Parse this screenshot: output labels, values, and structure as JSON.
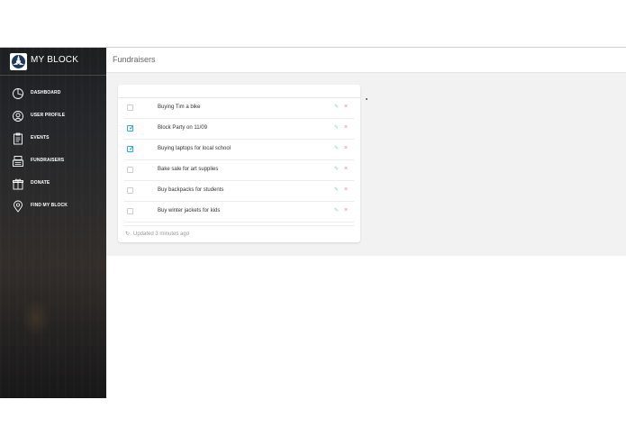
{
  "brand": {
    "name": "MY BLOCK"
  },
  "sidebar": {
    "items": [
      {
        "label": "DASHBOARD",
        "icon": "pie-chart-icon"
      },
      {
        "label": "USER PROFILE",
        "icon": "user-icon"
      },
      {
        "label": "EVENTS",
        "icon": "clipboard-icon"
      },
      {
        "label": "FUNDRAISERS",
        "icon": "cash-register-icon"
      },
      {
        "label": "DONATE",
        "icon": "gift-icon"
      },
      {
        "label": "FIND MY BLOCK",
        "icon": "map-pin-icon"
      }
    ]
  },
  "header": {
    "title": "Fundraisers"
  },
  "tasks": [
    {
      "text": "Buying Tim a bike",
      "checked": false
    },
    {
      "text": "Block Party on 11/09",
      "checked": true
    },
    {
      "text": "Buying laptops for local school",
      "checked": true
    },
    {
      "text": "Bake sale for art supplies",
      "checked": false
    },
    {
      "text": "Buy backpacks for students",
      "checked": false
    },
    {
      "text": "Buy winter jackets for kids",
      "checked": false
    }
  ],
  "footer": {
    "updated": "Updated 3 minutes ago"
  },
  "colors": {
    "accent": "#2aa8d8",
    "edit": "#7fd4c4",
    "remove": "#f08080"
  }
}
